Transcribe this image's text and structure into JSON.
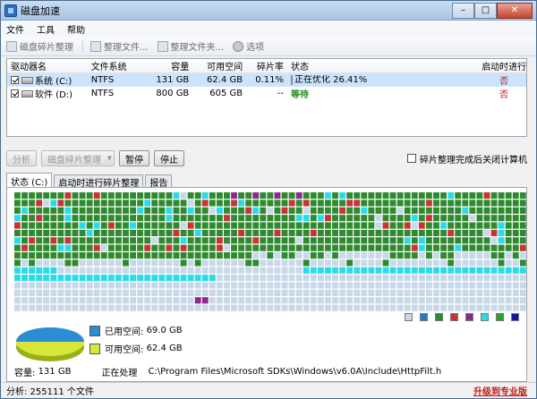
{
  "window": {
    "title": "磁盘加速",
    "controls": [
      "–",
      "□",
      "✕"
    ]
  },
  "menu": [
    "文件",
    "工具",
    "帮助"
  ],
  "toolbar": [
    {
      "label": "磁盘碎片整理",
      "icon": "defrag-icon"
    },
    {
      "label": "整理文件...",
      "icon": "file-icon"
    },
    {
      "label": "整理文件夹...",
      "icon": "folder-icon"
    },
    {
      "label": "选项",
      "icon": "gear-icon"
    }
  ],
  "drive_list": {
    "headers": [
      "驱动器名",
      "文件系统",
      "容量",
      "可用空间",
      "碎片率",
      "状态",
      "启动时进行碎..."
    ],
    "rows": [
      {
        "name": "系统 (C:)",
        "fs": "NTFS",
        "capacity": "131 GB",
        "free": "62.4 GB",
        "frag": "0.11%",
        "status": "正在优化 26.41%",
        "progress": 26.41,
        "boot": "否",
        "checked": true,
        "selected": true
      },
      {
        "name": "软件 (D:)",
        "fs": "NTFS",
        "capacity": "800 GB",
        "free": "605 GB",
        "frag": "--",
        "status": "等待",
        "progress": null,
        "boot": "否",
        "checked": true,
        "selected": false
      }
    ]
  },
  "actions": {
    "analyze": "分析",
    "defrag": "磁盘碎片整理",
    "pause": "暂停",
    "stop": "停止",
    "shutdown_option": "碎片整理完成后关闭计算机"
  },
  "tabs": [
    "状态 (C:)",
    "启动时进行碎片整理",
    "报告"
  ],
  "legend_colors": [
    "#c8d8e8",
    "#1f7fbf",
    "#2e8a2e",
    "#c83434",
    "#8b2a8b",
    "#29dbe6",
    "#2aa32a",
    "#1414a8"
  ],
  "space": {
    "used_label": "已用空间:",
    "used_value": "69.0 GB",
    "used_color": "#2a8dd6",
    "free_label": "可用空间:",
    "free_value": "62.4 GB",
    "free_color": "#d8e63a"
  },
  "info": {
    "capacity_label": "容量:",
    "capacity_value": "131 GB",
    "processing_label": "正在处理",
    "processing_path": "C:\\Program Files\\Microsoft SDKs\\Windows\\v6.0A\\Include\\HttpFilt.h"
  },
  "statusbar": {
    "text": "分析: 255111 个文件",
    "upgrade": "升级到专业版"
  }
}
